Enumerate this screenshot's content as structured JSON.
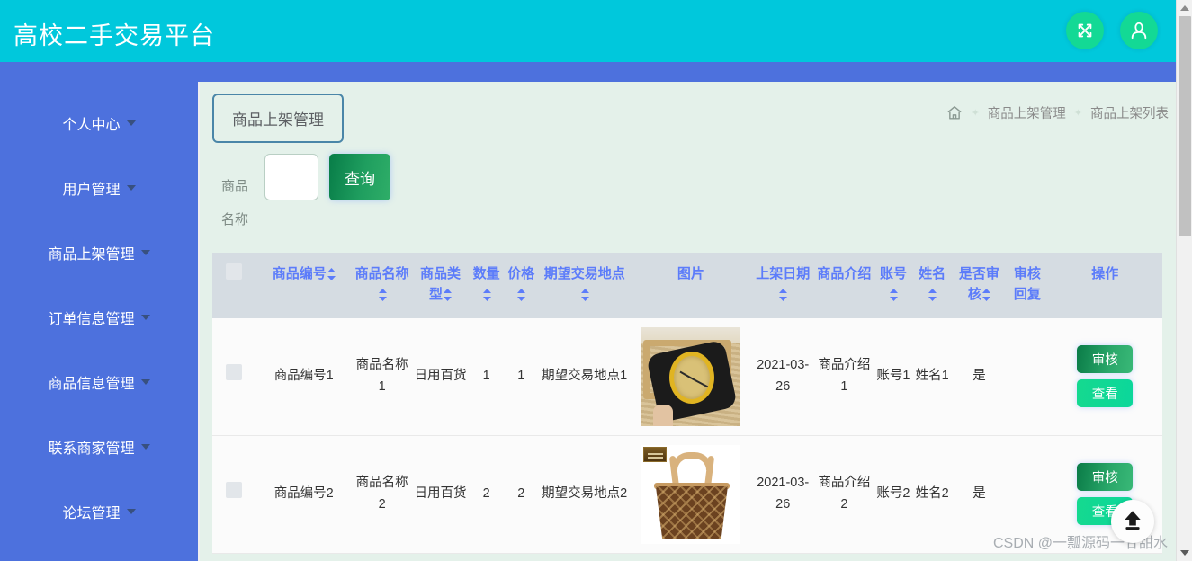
{
  "header": {
    "title": "高校二手交易平台",
    "fullscreen_icon": "fullscreen-icon",
    "user_icon": "user-icon",
    "background_color": "#00c8dc",
    "button_color": "#13d995"
  },
  "sidebar": {
    "background_color": "#4d71dd",
    "items": [
      {
        "label": "个人中心"
      },
      {
        "label": "用户管理"
      },
      {
        "label": "商品上架管理"
      },
      {
        "label": "订单信息管理"
      },
      {
        "label": "商品信息管理"
      },
      {
        "label": "联系商家管理"
      },
      {
        "label": "论坛管理"
      }
    ]
  },
  "main": {
    "tab_label": "商品上架管理",
    "breadcrumb": {
      "home_icon": "home-icon",
      "items": [
        "商品上架管理",
        "商品上架列表"
      ]
    },
    "search": {
      "label_line1": "商品",
      "label_line2": "名称",
      "input_value": "",
      "input_placeholder": "",
      "query_label": "查询"
    },
    "table": {
      "columns": [
        {
          "key": "checkbox",
          "label": "",
          "sortable": false
        },
        {
          "key": "code",
          "label": "商品编号",
          "sortable": true
        },
        {
          "key": "name",
          "label": "商品名称",
          "sortable": true
        },
        {
          "key": "type",
          "label": "商品类型",
          "sortable": true
        },
        {
          "key": "qty",
          "label": "数量",
          "sortable": true
        },
        {
          "key": "price",
          "label": "价格",
          "sortable": true
        },
        {
          "key": "place",
          "label": "期望交易地点",
          "sortable": true
        },
        {
          "key": "image",
          "label": "图片",
          "sortable": false
        },
        {
          "key": "date",
          "label": "上架日期",
          "sortable": true
        },
        {
          "key": "intro",
          "label": "商品介绍",
          "sortable": false
        },
        {
          "key": "account",
          "label": "账号",
          "sortable": true
        },
        {
          "key": "username",
          "label": "姓名",
          "sortable": true
        },
        {
          "key": "audited",
          "label": "是否审核",
          "sortable": true
        },
        {
          "key": "reply",
          "label": "审核回复",
          "sortable": false
        },
        {
          "key": "ops",
          "label": "操作",
          "sortable": false
        }
      ],
      "rows": [
        {
          "code": "商品编号1",
          "name": "商品名称1",
          "type": "日用百货",
          "qty": "1",
          "price": "1",
          "place": "期望交易地点1",
          "image": "watch-photo",
          "date": "2021-03-26",
          "intro": "商品介绍1",
          "account": "账号1",
          "username": "姓名1",
          "audited": "是",
          "reply": "",
          "audit_label": "审核",
          "view_label": "查看"
        },
        {
          "code": "商品编号2",
          "name": "商品名称2",
          "type": "日用百货",
          "qty": "2",
          "price": "2",
          "place": "期望交易地点2",
          "image": "handbag-photo",
          "date": "2021-03-26",
          "intro": "商品介绍2",
          "account": "账号2",
          "username": "姓名2",
          "audited": "是",
          "reply": "",
          "audit_label": "审核",
          "view_label": "查看"
        }
      ]
    },
    "watermark": "CSDN @一瓢源码一甘甜水",
    "back_to_top_icon": "arrow-up-icon"
  },
  "colors": {
    "accent_green": "#13d995",
    "header_cyan": "#00c8dc",
    "sidebar_blue": "#4d71dd",
    "table_header_bg": "#d5dce2",
    "table_header_text": "#5c7cfa",
    "content_bg": "#e4f1ea"
  }
}
